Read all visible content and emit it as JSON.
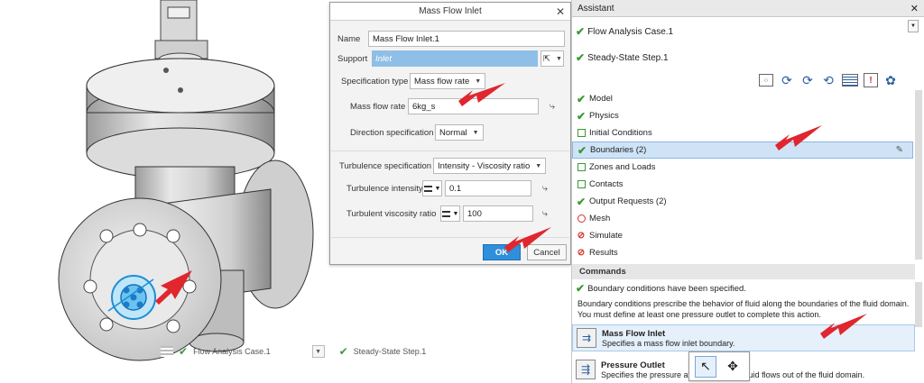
{
  "viewport": {
    "bottom_bar": {
      "case_label": "Flow Analysis Case.1",
      "step_label": "Steady-State Step.1"
    }
  },
  "dialog": {
    "title": "Mass Flow Inlet",
    "name_label": "Name",
    "name_value": "Mass Flow Inlet.1",
    "support_label": "Support",
    "support_value": "Inlet",
    "spec_type_label": "Specification type",
    "spec_type_value": "Mass flow rate",
    "mass_flow_label": "Mass flow rate",
    "mass_flow_value": "6kg_s",
    "direction_label": "Direction specification",
    "direction_value": "Normal",
    "turb_spec_label": "Turbulence specification",
    "turb_spec_value": "Intensity - Viscosity ratio",
    "turb_int_label": "Turbulence intensity",
    "turb_int_value": "0.1",
    "turb_visc_label": "Turbulent viscosity ratio",
    "turb_visc_value": "100",
    "ok_label": "OK",
    "cancel_label": "Cancel"
  },
  "assistant": {
    "title": "Assistant",
    "case": "Flow Analysis Case.1",
    "step": "Steady-State Step.1",
    "steps": [
      {
        "label": "Model",
        "status": "done"
      },
      {
        "label": "Physics",
        "status": "done"
      },
      {
        "label": "Initial Conditions",
        "status": "optional"
      },
      {
        "label": "Boundaries (2)",
        "status": "done",
        "selected": true
      },
      {
        "label": "Zones and Loads",
        "status": "optional"
      },
      {
        "label": "Contacts",
        "status": "optional"
      },
      {
        "label": "Output Requests (2)",
        "status": "done"
      },
      {
        "label": "Mesh",
        "status": "todo"
      },
      {
        "label": "Simulate",
        "status": "blocked"
      },
      {
        "label": "Results",
        "status": "blocked"
      }
    ],
    "commands_header": "Commands",
    "status_msg": "Boundary conditions have been specified.",
    "desc_line1": "Boundary conditions prescribe the behavior of fluid along the boundaries of the fluid domain.",
    "desc_line2": "You must define at least one pressure outlet to complete this action.",
    "commands": [
      {
        "title": "Mass Flow Inlet",
        "sub": "Specifies a mass flow inlet boundary."
      },
      {
        "title": "Pressure Outlet",
        "sub": "Specifies the pressure at",
        "sub_tail": "fluid flows out of the fluid domain."
      }
    ]
  },
  "colors": {
    "accent": "#2f8fdb",
    "check": "#3a9a35",
    "arrow": "#e0262e",
    "selection": "#cfe3f7"
  }
}
